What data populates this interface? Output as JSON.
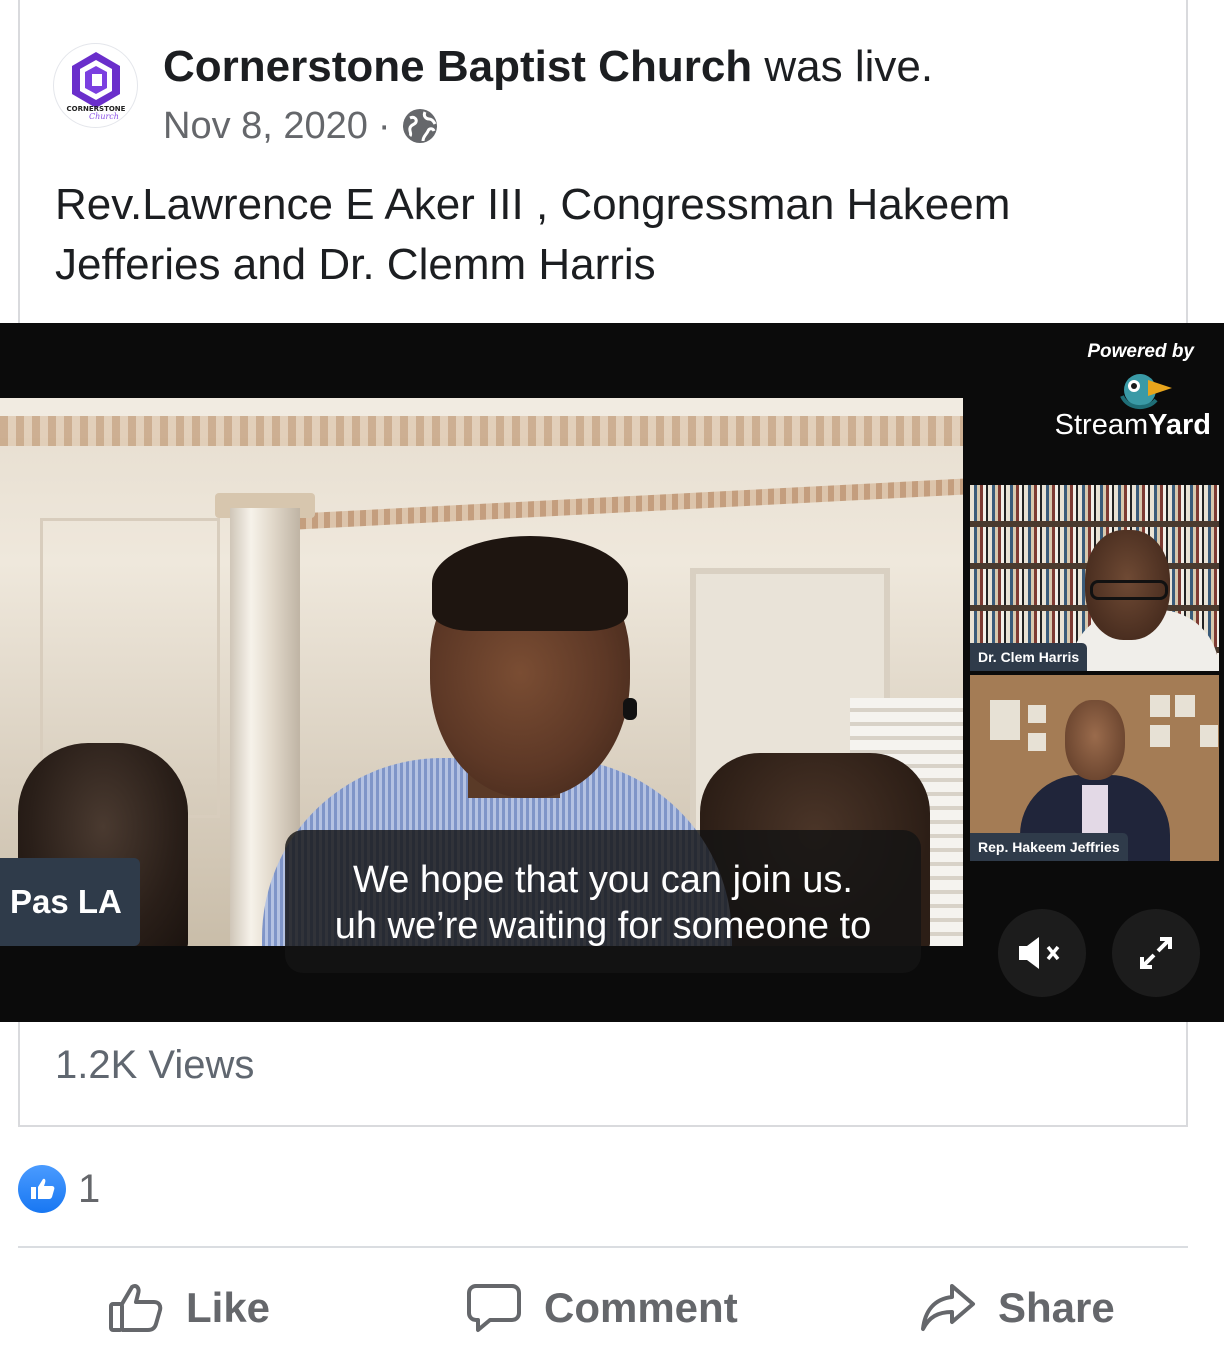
{
  "post": {
    "page_name": "Cornerstone Baptist Church",
    "status_suffix": "was live.",
    "date": "Nov 8, 2020",
    "separator": "·",
    "privacy_icon": "globe-icon",
    "avatar_text_top": "CORNERSTONE",
    "avatar_text_bottom": "Church",
    "text": "Rev.Lawrence E Aker III , Congressman Hakeem Jefferies and Dr. Clemm Harris"
  },
  "video": {
    "powered_by": "Powered by",
    "brand_part1": "Stream",
    "brand_part2": "Yard",
    "main_speaker_label": "Pas LA",
    "caption_line1": "We hope that you can join us.",
    "caption_line2": "uh we’re waiting for someone to",
    "guest1_label": "Dr. Clem Harris",
    "guest2_label": "Rep. Hakeem Jeffries",
    "mute_icon": "muted-speaker-icon",
    "fullscreen_icon": "fullscreen-expand-icon"
  },
  "stats": {
    "views": "1.2K Views",
    "like_count": "1"
  },
  "actions": {
    "like": "Like",
    "comment": "Comment",
    "share": "Share"
  },
  "colors": {
    "brand_blue": "#1877f2",
    "text_primary": "#1c1e21",
    "text_secondary": "#65676b",
    "logo_purple": "#6a2ecb",
    "label_bg": "#2f3b4a"
  }
}
